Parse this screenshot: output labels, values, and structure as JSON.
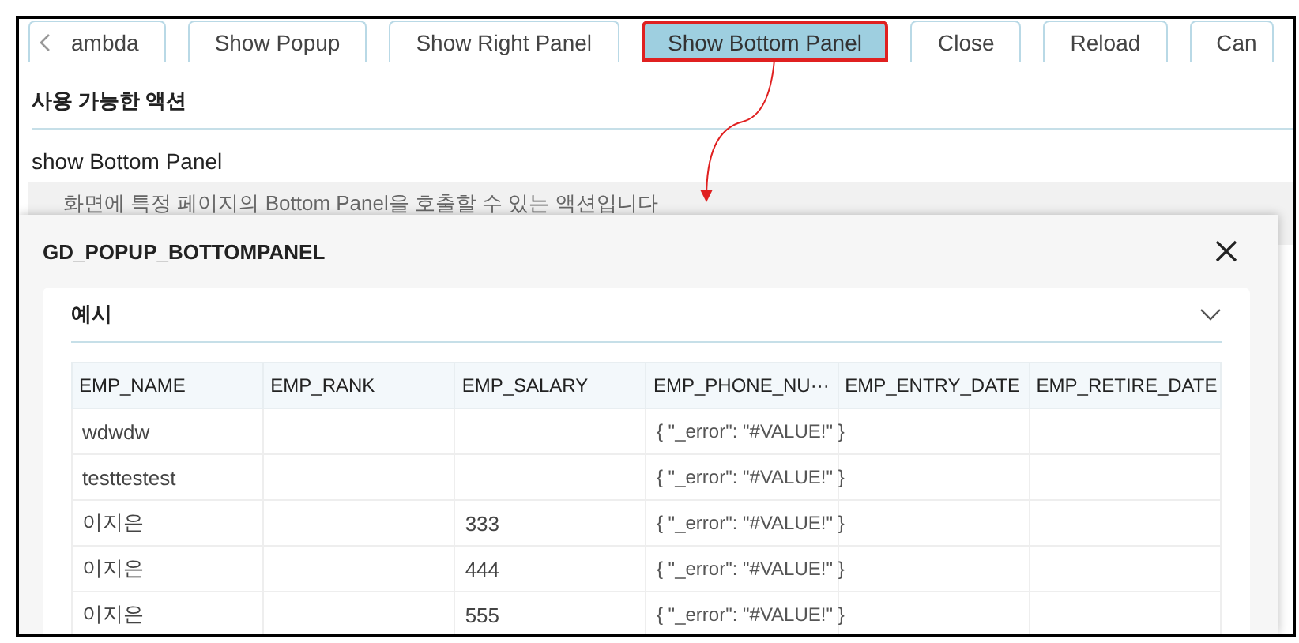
{
  "tabs": [
    {
      "label": "ambda",
      "selected": false,
      "highlighted": false
    },
    {
      "label": "Show Popup",
      "selected": false,
      "highlighted": false
    },
    {
      "label": "Show Right Panel",
      "selected": false,
      "highlighted": false
    },
    {
      "label": "Show Bottom Panel",
      "selected": true,
      "highlighted": true
    },
    {
      "label": "Close",
      "selected": false,
      "highlighted": false
    },
    {
      "label": "Reload",
      "selected": false,
      "highlighted": false
    },
    {
      "label": "Can",
      "selected": false,
      "highlighted": false
    }
  ],
  "section": {
    "title": "사용 가능한 액션",
    "action_name": "show Bottom Panel",
    "description": "화면에 특정 페이지의 Bottom Panel을 호출할 수 있는 액션입니다"
  },
  "popup": {
    "title": "GD_POPUP_BOTTOMPANEL",
    "card": {
      "title": "예시",
      "expanded": true
    },
    "table": {
      "columns": [
        "EMP_NAME",
        "EMP_RANK",
        "EMP_SALARY",
        "EMP_PHONE_NU···",
        "EMP_ENTRY_DATE",
        "EMP_RETIRE_DATE"
      ],
      "rows": [
        [
          "wdwdw",
          "",
          "",
          "{ \"_error\": \"#VALUE!\" }",
          "",
          ""
        ],
        [
          "testtestest",
          "",
          "",
          "{ \"_error\": \"#VALUE!\" }",
          "",
          ""
        ],
        [
          "이지은",
          "",
          "333",
          "{ \"_error\": \"#VALUE!\" }",
          "",
          ""
        ],
        [
          "이지은",
          "",
          "444",
          "{ \"_error\": \"#VALUE!\" }",
          "",
          ""
        ],
        [
          "이지은",
          "",
          "555",
          "{ \"_error\": \"#VALUE!\" }",
          "",
          ""
        ]
      ]
    }
  }
}
